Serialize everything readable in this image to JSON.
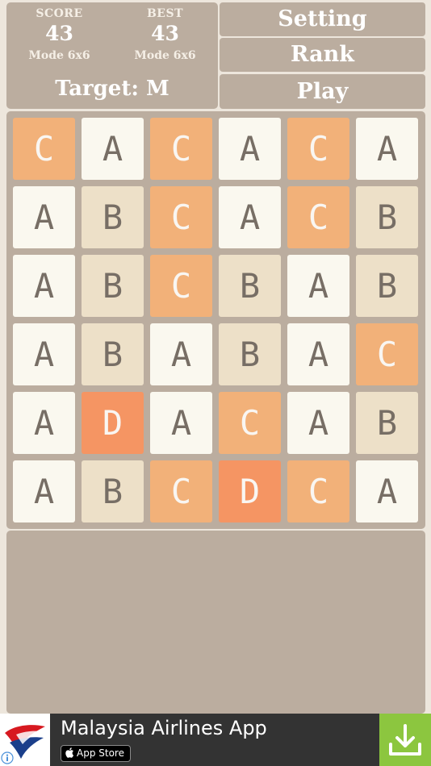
{
  "header": {
    "score": {
      "label": "SCORE",
      "value": "43",
      "mode": "Mode 6x6"
    },
    "best": {
      "label": "BEST",
      "value": "43",
      "mode": "Mode 6x6"
    },
    "target": "Target: M"
  },
  "menu": {
    "setting": "Setting",
    "rank": "Rank",
    "play": "Play"
  },
  "board": {
    "size": 6,
    "rows": [
      [
        "C",
        "A",
        "C",
        "A",
        "C",
        "A"
      ],
      [
        "A",
        "B",
        "C",
        "A",
        "C",
        "B"
      ],
      [
        "A",
        "B",
        "C",
        "B",
        "A",
        "B"
      ],
      [
        "A",
        "B",
        "A",
        "B",
        "A",
        "C"
      ],
      [
        "A",
        "D",
        "A",
        "C",
        "A",
        "B"
      ],
      [
        "A",
        "B",
        "C",
        "D",
        "C",
        "A"
      ]
    ]
  },
  "tile_colors": {
    "A": "#faf8ef",
    "B": "#ede0c8",
    "C": "#f2b179",
    "D": "#f59563"
  },
  "ad": {
    "title": "Malaysia Airlines App",
    "store_label": "App Store",
    "accent": "#8cc63f",
    "icons": {
      "logo": "malaysia-airlines-logo",
      "download": "download-icon",
      "info": "info-icon"
    }
  }
}
